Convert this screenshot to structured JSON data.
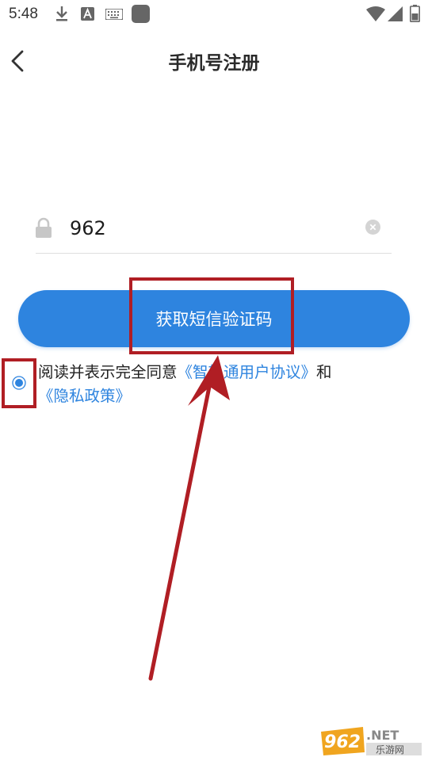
{
  "status_bar": {
    "time": "5:48",
    "icons": [
      "download-icon",
      "text-a-icon",
      "keyboard-icon",
      "app-square-icon",
      "wifi-icon",
      "signal-icon",
      "battery-icon"
    ]
  },
  "header": {
    "back_icon": "chevron-left-icon",
    "title": "手机号注册"
  },
  "phone_form": {
    "field_icon": "lock-icon",
    "value": "962",
    "clear_icon": "clear-circle-icon",
    "submit_label": "获取短信验证码"
  },
  "agreement": {
    "checked": true,
    "prefix": "阅读并表示完全同意",
    "terms_link": "《智轨通用户协议》",
    "conjunction": "和",
    "privacy_link": "《隐私政策》"
  },
  "watermark": {
    "number": "962",
    "domain": ".NET",
    "tagline": "乐游网"
  },
  "colors": {
    "accent": "#2e84df",
    "annotation": "#b01e24"
  }
}
